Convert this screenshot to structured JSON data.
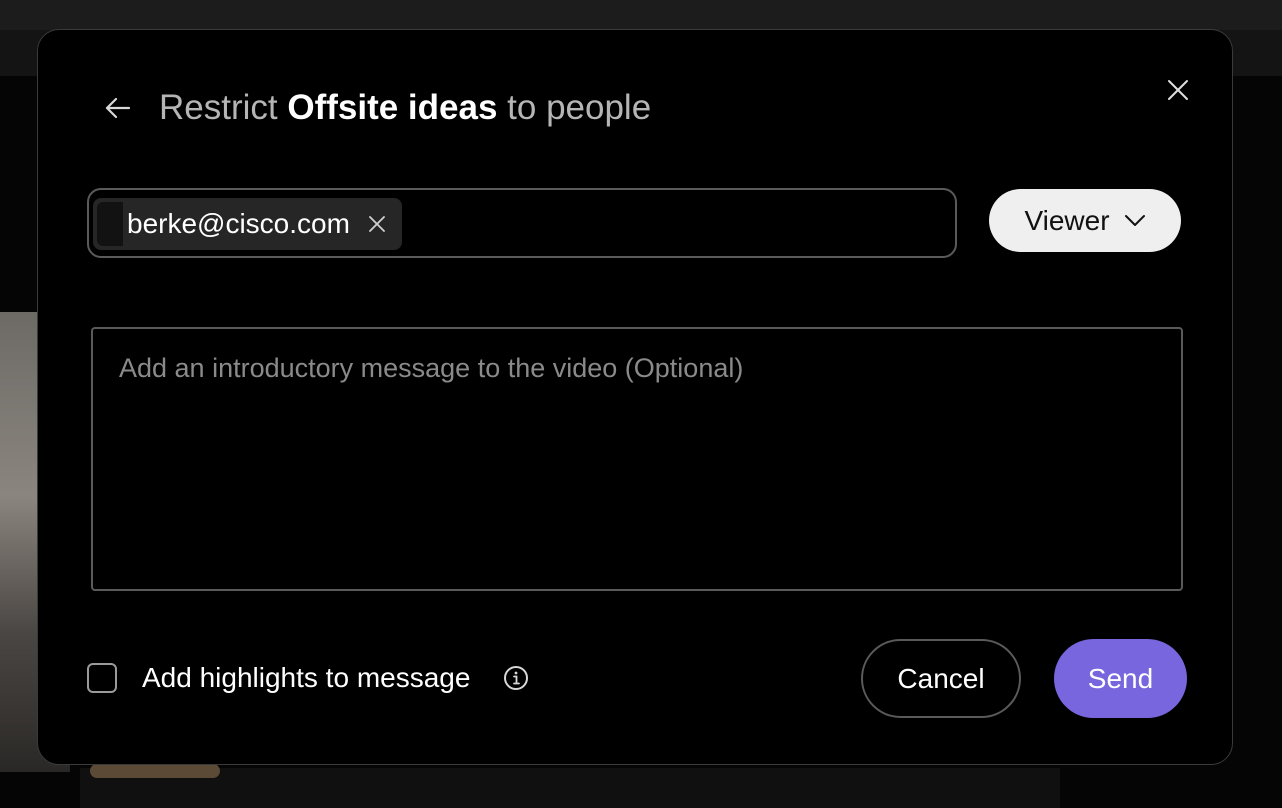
{
  "dialog": {
    "title": {
      "prefix": "Restrict ",
      "item_name": "Offsite ideas",
      "suffix": " to people"
    },
    "back_icon": "arrow-left-icon",
    "close_icon": "close-icon"
  },
  "recipients": {
    "chips": [
      {
        "email": "berke@cisco.com",
        "remove_icon": "close-icon"
      }
    ]
  },
  "role_selector": {
    "selected": "Viewer",
    "icon": "chevron-down-icon"
  },
  "message": {
    "value": "",
    "placeholder": "Add an introductory message to the video (Optional)"
  },
  "highlights": {
    "label": "Add highlights to message",
    "checked": false,
    "info_icon": "info-icon"
  },
  "actions": {
    "cancel_label": "Cancel",
    "send_label": "Send"
  },
  "colors": {
    "dialog_bg": "#000000",
    "border": "#5a5a5a",
    "accent": "#7766dd",
    "role_button_bg": "#efefef",
    "chip_bg": "#262626"
  }
}
